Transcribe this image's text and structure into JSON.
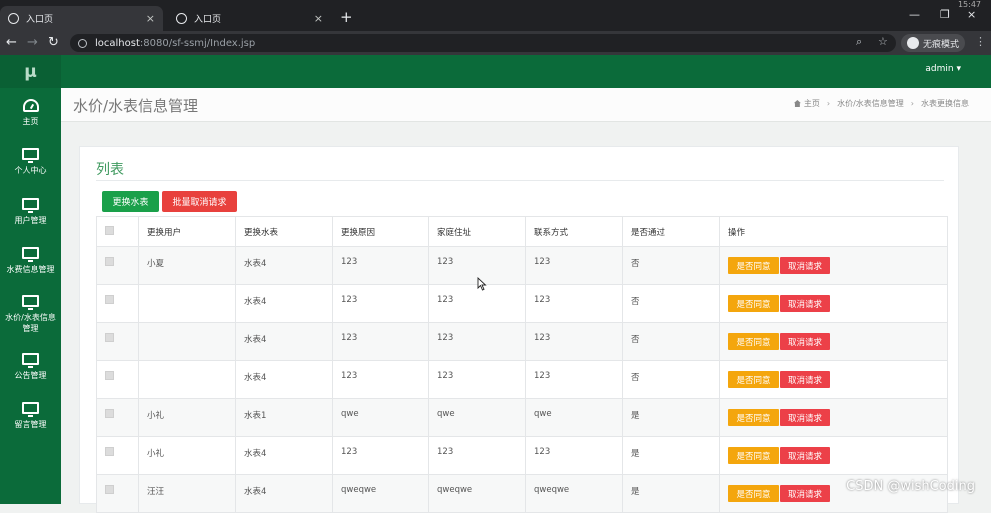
{
  "browser": {
    "tabs": [
      {
        "label": "入口页",
        "active": true
      },
      {
        "label": "入口页",
        "active": false
      }
    ],
    "new_tab": "+",
    "close_glyph": "×",
    "url_host": "localhost",
    "url_path": ":8080/sf-ssmj/Index.jsp",
    "incognito_label": "无痕模式",
    "clock": "15:47"
  },
  "app": {
    "logo": "μ",
    "user": "admin ▾",
    "sidebar": [
      {
        "label": "主页",
        "icon": "dashboard-icon"
      },
      {
        "label": "个人中心",
        "icon": "monitor-icon"
      },
      {
        "label": "用户管理",
        "icon": "monitor-icon"
      },
      {
        "label": "水费信息管理",
        "icon": "monitor-icon"
      },
      {
        "label": "水价/水表信息管理",
        "icon": "monitor-icon"
      },
      {
        "label": "公告管理",
        "icon": "monitor-icon"
      },
      {
        "label": "留言管理",
        "icon": "monitor-icon"
      }
    ]
  },
  "page": {
    "title": "水价/水表信息管理",
    "breadcrumb": [
      "主页",
      "水价/水表信息管理",
      "水表更换信息"
    ],
    "card_title": "列表",
    "btn_replace": "更换水表",
    "btn_batch_cancel": "批量取消请求"
  },
  "table": {
    "headers": [
      "更换用户",
      "更换水表",
      "更换原因",
      "家庭住址",
      "联系方式",
      "是否通过",
      "操作"
    ],
    "rows": [
      {
        "user": "小夏",
        "meter": "水表4",
        "reason": "123",
        "address": "123",
        "contact": "123",
        "passed": "否"
      },
      {
        "user": "",
        "meter": "水表4",
        "reason": "123",
        "address": "123",
        "contact": "123",
        "passed": "否"
      },
      {
        "user": "",
        "meter": "水表4",
        "reason": "123",
        "address": "123",
        "contact": "123",
        "passed": "否"
      },
      {
        "user": "",
        "meter": "水表4",
        "reason": "123",
        "address": "123",
        "contact": "123",
        "passed": "否"
      },
      {
        "user": "小礼",
        "meter": "水表1",
        "reason": "qwe",
        "address": "qwe",
        "contact": "qwe",
        "passed": "是"
      },
      {
        "user": "小礼",
        "meter": "水表4",
        "reason": "123",
        "address": "123",
        "contact": "123",
        "passed": "是"
      },
      {
        "user": "汪汪",
        "meter": "水表4",
        "reason": "qweqwe",
        "address": "qweqwe",
        "contact": "qweqwe",
        "passed": "是"
      }
    ],
    "action_agree": "是否同意",
    "action_cancel": "取消请求"
  },
  "watermark": "CSDN @wishCoding",
  "colors": {
    "sidebar": "#0b6b3a",
    "green_button": "#1aa04a",
    "red_button": "#e8413d",
    "yellow_button": "#f4a60d",
    "card_title": "#3f9a5f"
  }
}
